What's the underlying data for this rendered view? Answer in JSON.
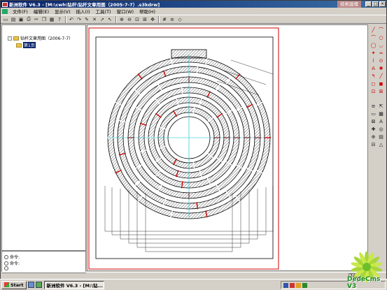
{
  "title": "新洲软件 V6.3 - [M:\\cwh\\钻杆\\钻杆文章用图（2005-7-7）.s3kdrw]",
  "brand_label": "技術論壇",
  "window_controls": {
    "min": "_",
    "max": "□",
    "close": "×"
  },
  "menu": [
    "文件(F)",
    "编辑(E)",
    "显示(V)",
    "插入(I)",
    "工具(T)",
    "窗口(W)",
    "帮助(H)"
  ],
  "toolbar_icons": [
    "new-icon",
    "open-icon",
    "save-icon",
    "print-icon",
    "cut-icon",
    "copy-icon",
    "paste-icon",
    "help-icon",
    "undo-icon",
    "redo-icon",
    "pen-icon",
    "delete-icon",
    "select-icon",
    "arrow-icon",
    "zoom-in-icon",
    "zoom-out-icon",
    "zoom-window-icon",
    "zoom-fit-icon",
    "pan-icon",
    "grid-icon",
    "layer-icon",
    "snap-icon"
  ],
  "tree": {
    "root_label": "钻杆文章用图（2006-7-7）",
    "page_label": "第1页"
  },
  "command_panel": {
    "lines": [
      "命令:",
      "命令:"
    ]
  },
  "status": {
    "coords": "742.237"
  },
  "taskbar": {
    "start_label": "Start",
    "task_label": "新洲软件 V6.3 - [M:\\钻..."
  },
  "watermark": "DedeCms V3",
  "drawing": {
    "ring_count": 7,
    "colors": {
      "border": "#cc0000",
      "outline": "#000000",
      "centerline": "#00bcd4",
      "hatch": "#333333"
    }
  }
}
